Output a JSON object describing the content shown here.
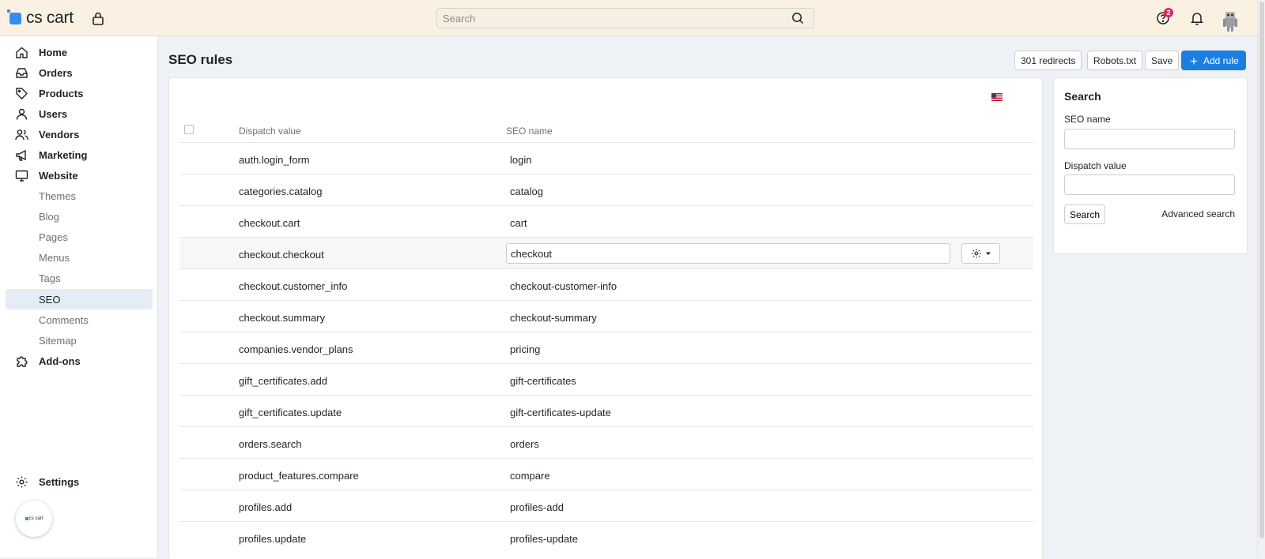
{
  "app": {
    "logo_text": "cs cart",
    "mini_logo_text": "cs cart"
  },
  "topbar": {
    "search_placeholder": "Search",
    "notification_count": "2"
  },
  "sidebar": {
    "items": [
      {
        "label": "Home",
        "icon": "home-icon"
      },
      {
        "label": "Orders",
        "icon": "inbox-icon"
      },
      {
        "label": "Products",
        "icon": "tag-icon"
      },
      {
        "label": "Users",
        "icon": "user-icon"
      },
      {
        "label": "Vendors",
        "icon": "users-icon"
      },
      {
        "label": "Marketing",
        "icon": "megaphone-icon"
      },
      {
        "label": "Website",
        "icon": "monitor-icon"
      },
      {
        "label": "Themes"
      },
      {
        "label": "Blog"
      },
      {
        "label": "Pages"
      },
      {
        "label": "Menus"
      },
      {
        "label": "Tags"
      },
      {
        "label": "SEO",
        "active": true
      },
      {
        "label": "Comments"
      },
      {
        "label": "Sitemap"
      },
      {
        "label": "Add-ons",
        "icon": "puzzle-icon"
      },
      {
        "label": "Settings",
        "icon": "gear-icon"
      }
    ]
  },
  "page": {
    "title": "SEO rules",
    "buttons": {
      "redirects": "301 redirects",
      "robots": "Robots.txt",
      "save": "Save",
      "add_rule": "Add rule"
    }
  },
  "table": {
    "headers": {
      "dispatch": "Dispatch value",
      "seo": "SEO name"
    },
    "rows": [
      {
        "dispatch": "auth.login_form",
        "seo": "login"
      },
      {
        "dispatch": "categories.catalog",
        "seo": "catalog"
      },
      {
        "dispatch": "checkout.cart",
        "seo": "cart"
      },
      {
        "dispatch": "checkout.checkout",
        "seo": "checkout"
      },
      {
        "dispatch": "checkout.customer_info",
        "seo": "checkout-customer-info"
      },
      {
        "dispatch": "checkout.summary",
        "seo": "checkout-summary"
      },
      {
        "dispatch": "companies.vendor_plans",
        "seo": "pricing"
      },
      {
        "dispatch": "gift_certificates.add",
        "seo": "gift-certificates"
      },
      {
        "dispatch": "gift_certificates.update",
        "seo": "gift-certificates-update"
      },
      {
        "dispatch": "orders.search",
        "seo": "orders"
      },
      {
        "dispatch": "product_features.compare",
        "seo": "compare"
      },
      {
        "dispatch": "profiles.add",
        "seo": "profiles-add"
      },
      {
        "dispatch": "profiles.update",
        "seo": "profiles-update"
      }
    ]
  },
  "search_panel": {
    "title": "Search",
    "seo_name_label": "SEO name",
    "dispatch_label": "Dispatch value",
    "search_button": "Search",
    "advanced": "Advanced search"
  },
  "colors": {
    "accent": "#1a7fe0",
    "topbar_bg": "#fbf1e3",
    "badge": "#e0245e"
  }
}
